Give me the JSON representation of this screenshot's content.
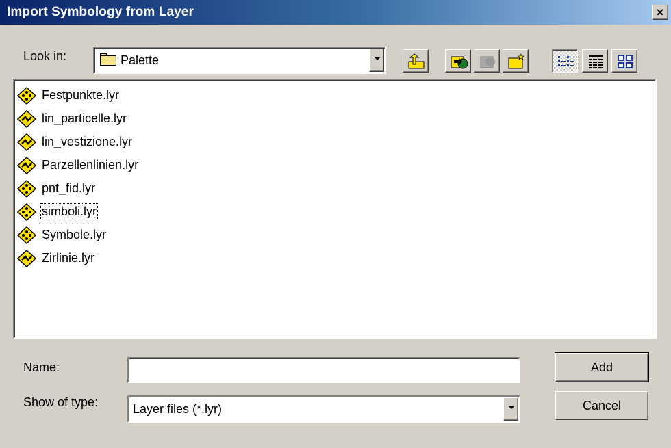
{
  "window": {
    "title": "Import Symbology from Layer",
    "close_glyph": "×"
  },
  "look_in": {
    "label": "Look in:",
    "value": "Palette",
    "icon": "folder-icon"
  },
  "toolbar": {
    "buttons": [
      {
        "name": "up-one-level",
        "icon": "up-folder-icon"
      },
      {
        "name": "connect-to-folder",
        "icon": "connect-folder-icon"
      },
      {
        "name": "disconnect-from-folder",
        "icon": "disconnect-folder-icon"
      },
      {
        "name": "new-folder",
        "icon": "new-folder-icon"
      },
      {
        "name": "list-view",
        "icon": "list-view-icon",
        "active": true
      },
      {
        "name": "details-view",
        "icon": "details-view-icon"
      },
      {
        "name": "thumbnails-view",
        "icon": "thumbnails-view-icon"
      }
    ]
  },
  "files": [
    {
      "name": "Festpunkte.lyr",
      "icon": "point-layer-icon"
    },
    {
      "name": "lin_particelle.lyr",
      "icon": "line-layer-icon"
    },
    {
      "name": "lin_vestizione.lyr",
      "icon": "line-layer-icon"
    },
    {
      "name": "Parzellenlinien.lyr",
      "icon": "line-layer-icon"
    },
    {
      "name": "pnt_fid.lyr",
      "icon": "point-layer-icon"
    },
    {
      "name": "simboli.lyr",
      "icon": "point-layer-icon",
      "focused": true
    },
    {
      "name": "Symbole.lyr",
      "icon": "point-layer-icon"
    },
    {
      "name": "Zirlinie.lyr",
      "icon": "line-layer-icon"
    }
  ],
  "name_field": {
    "label": "Name:",
    "value": ""
  },
  "type_field": {
    "label": "Show of type:",
    "value": "Layer files (*.lyr)"
  },
  "buttons": {
    "add": "Add",
    "cancel": "Cancel"
  },
  "colors": {
    "title_start": "#0a246a",
    "title_end": "#a6caf0",
    "face": "#d4d0c8",
    "icon_yellow": "#ffe000"
  }
}
